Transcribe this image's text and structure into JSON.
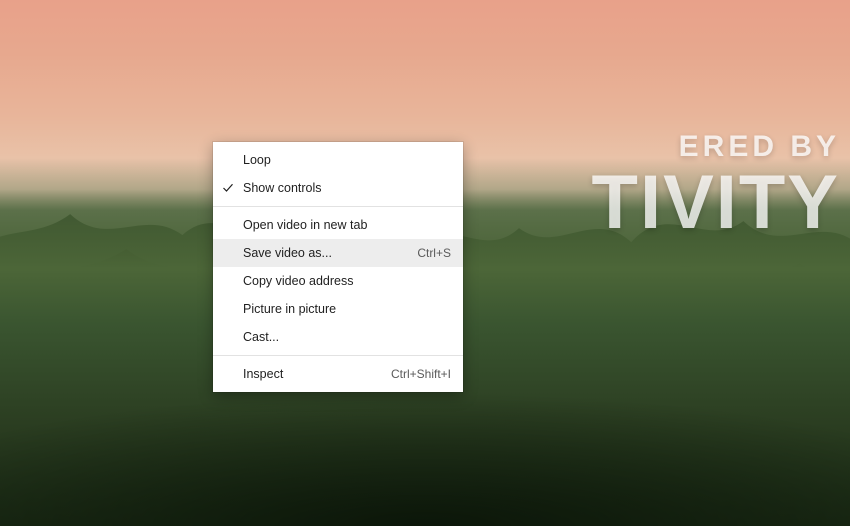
{
  "video_overlay": {
    "line1_fragment": "ERED BY",
    "line2_fragment": "TIVITY"
  },
  "context_menu": {
    "groups": [
      [
        {
          "label": "Loop",
          "checked": false,
          "shortcut": ""
        },
        {
          "label": "Show controls",
          "checked": true,
          "shortcut": ""
        }
      ],
      [
        {
          "label": "Open video in new tab",
          "checked": false,
          "shortcut": ""
        },
        {
          "label": "Save video as...",
          "checked": false,
          "shortcut": "Ctrl+S",
          "hover": true
        },
        {
          "label": "Copy video address",
          "checked": false,
          "shortcut": ""
        },
        {
          "label": "Picture in picture",
          "checked": false,
          "shortcut": ""
        },
        {
          "label": "Cast...",
          "checked": false,
          "shortcut": ""
        }
      ],
      [
        {
          "label": "Inspect",
          "checked": false,
          "shortcut": "Ctrl+Shift+I"
        }
      ]
    ]
  }
}
